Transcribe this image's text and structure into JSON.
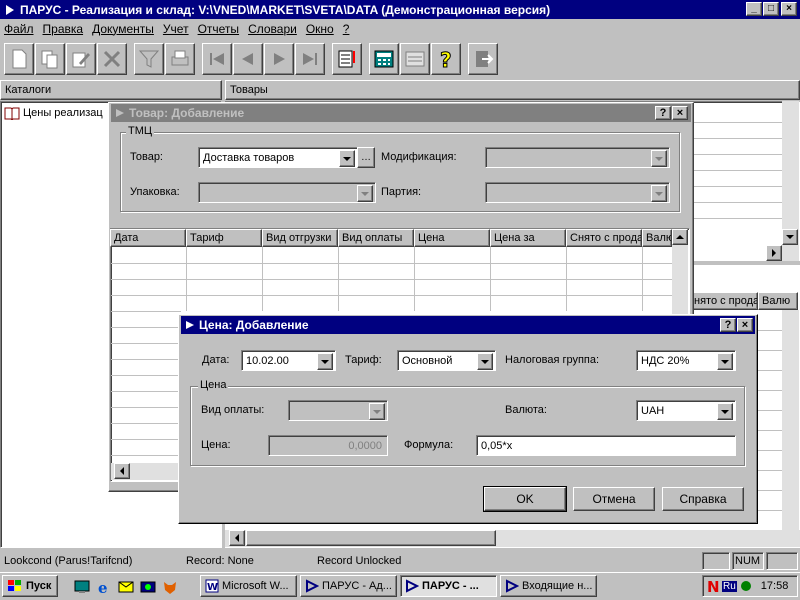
{
  "window": {
    "title": "ПАРУС - Реализация и склад: V:\\VNED\\MARKET\\SVETA\\DATA (Демонстрационная версия)"
  },
  "menu": [
    "Файл",
    "Правка",
    "Документы",
    "Учет",
    "Отчеты",
    "Словари",
    "Окно",
    "?"
  ],
  "panels": {
    "catalogs_header": "Каталоги",
    "goods_header": "Товары",
    "catalog_item": "Цены реализац"
  },
  "goods_bg_cols": [
    "нято с прода",
    "Валю"
  ],
  "dlg_goods": {
    "title": "Товар: Добавление",
    "group_title": "ТМЦ",
    "tovar_label": "Товар:",
    "tovar_value": "Доставка товаров",
    "modif_label": "Модификация:",
    "upak_label": "Упаковка:",
    "partia_label": "Партия:",
    "columns": [
      "Дата",
      "Тариф",
      "Вид отгрузки",
      "Вид оплаты",
      "Цена",
      "Цена за",
      "Снято с прода",
      "Валю"
    ]
  },
  "dlg_price": {
    "title": "Цена: Добавление",
    "date_label": "Дата:",
    "date_value": "10.02.00",
    "tarif_label": "Тариф:",
    "tarif_value": "Основной",
    "tax_label": "Налоговая группа:",
    "tax_value": "НДС 20%",
    "group_title": "Цена",
    "pay_label": "Вид оплаты:",
    "currency_label": "Валюта:",
    "currency_value": "UAH",
    "price_label": "Цена:",
    "price_value": "0,0000",
    "formula_label": "Формула:",
    "formula_value": "0,05*x",
    "ok": "OK",
    "cancel": "Отмена",
    "help": "Справка"
  },
  "status": {
    "lookup": "Lookcond (Parus!Tarifcnd)",
    "record": "Record: None",
    "lock": "Record Unlocked",
    "num": "NUM"
  },
  "taskbar": {
    "start": "Пуск",
    "tasks": [
      "Microsoft W...",
      "ПАРУС - Ад...",
      "ПАРУС - ...",
      "Входящие н..."
    ],
    "lang": "Ru",
    "time": "17:58"
  }
}
